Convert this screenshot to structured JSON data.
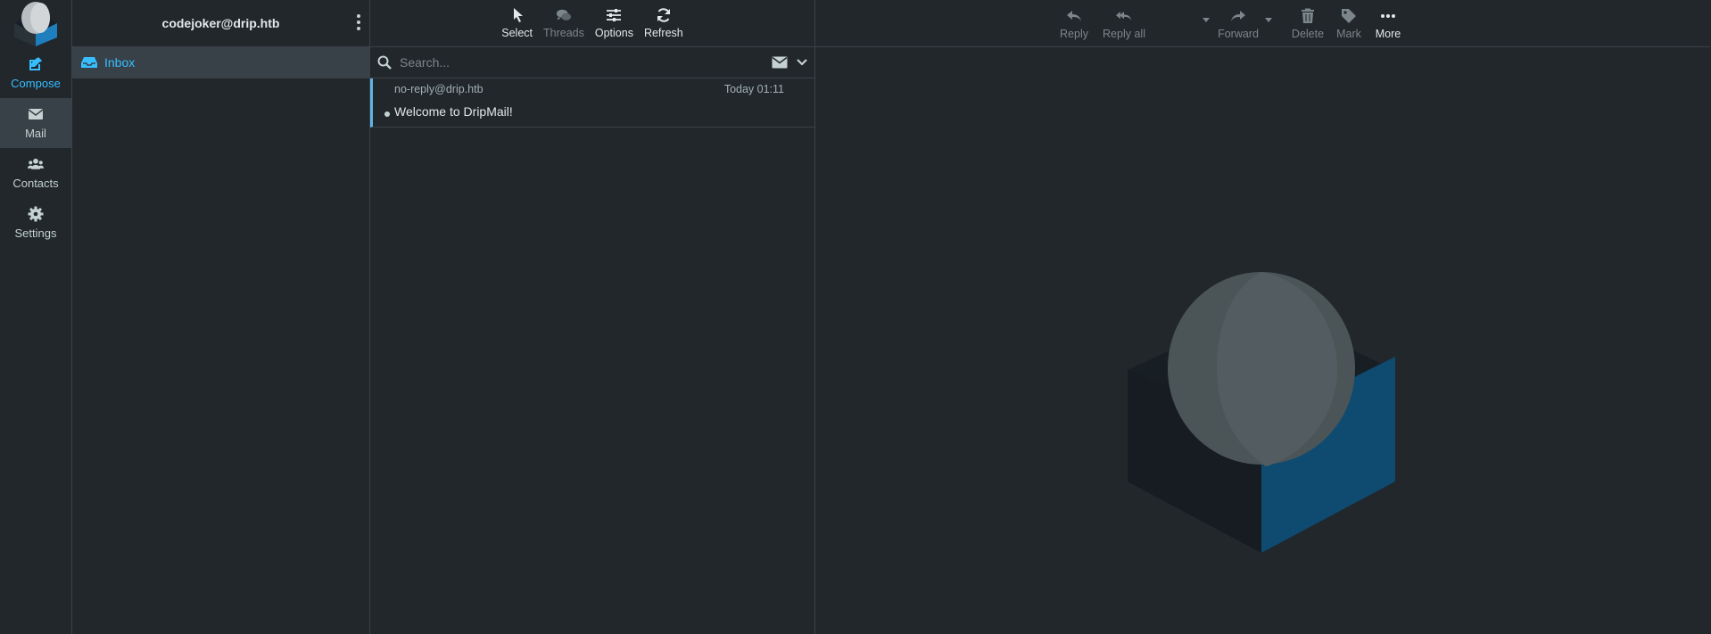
{
  "account": {
    "email": "codejoker@drip.htb"
  },
  "rail": {
    "items": [
      {
        "label": "Compose",
        "icon": "compose-icon"
      },
      {
        "label": "Mail",
        "icon": "envelope-icon"
      },
      {
        "label": "Contacts",
        "icon": "users-icon"
      },
      {
        "label": "Settings",
        "icon": "gear-icon"
      }
    ]
  },
  "folders": [
    {
      "label": "Inbox",
      "icon": "inbox-icon",
      "active": true
    }
  ],
  "list_toolbar": {
    "select": "Select",
    "threads": "Threads",
    "options": "Options",
    "refresh": "Refresh"
  },
  "search": {
    "placeholder": "Search..."
  },
  "messages": [
    {
      "from": "no-reply@drip.htb",
      "date": "Today 01:11",
      "subject": "Welcome to DripMail!",
      "unread": true
    }
  ],
  "preview_toolbar": {
    "reply": "Reply",
    "reply_all": "Reply all",
    "forward": "Forward",
    "delete": "Delete",
    "mark": "Mark",
    "more": "More"
  },
  "colors": {
    "accent": "#37beff",
    "background": "#21272b",
    "active_item": "#374147",
    "logo_blue": "#0f4b71"
  }
}
